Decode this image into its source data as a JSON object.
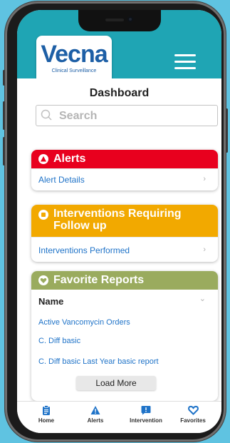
{
  "app": {
    "logo_text": "Vecna",
    "logo_subtitle": "Clinical Surveillance",
    "brand_color": "#1fa5b4"
  },
  "page": {
    "title": "Dashboard"
  },
  "search": {
    "placeholder": "Search"
  },
  "alerts_card": {
    "title": "Alerts",
    "color": "#e8001e",
    "icon": "warning-icon",
    "rows": [
      {
        "label": "Alert Details"
      }
    ]
  },
  "interventions_card": {
    "title": "Interventions Requiring Follow up",
    "color": "#f2a900",
    "icon": "message-icon",
    "rows": [
      {
        "label": "Interventions Performed"
      }
    ]
  },
  "favorites_card": {
    "title": "Favorite Reports",
    "color": "#9aab5e",
    "icon": "heart-icon",
    "column_header": "Name",
    "items": [
      "Active Vancomycin Orders",
      "C. Diff basic",
      "C. Diff basic Last Year basic report"
    ],
    "load_more_label": "Load More"
  },
  "tabbar": {
    "tabs": [
      {
        "label": "Home",
        "icon": "clipboard-icon"
      },
      {
        "label": "Alerts",
        "icon": "warning-icon"
      },
      {
        "label": "Intervention",
        "icon": "message-icon"
      },
      {
        "label": "Favorites",
        "icon": "heart-icon"
      }
    ],
    "icon_color": "#1f73c8"
  }
}
